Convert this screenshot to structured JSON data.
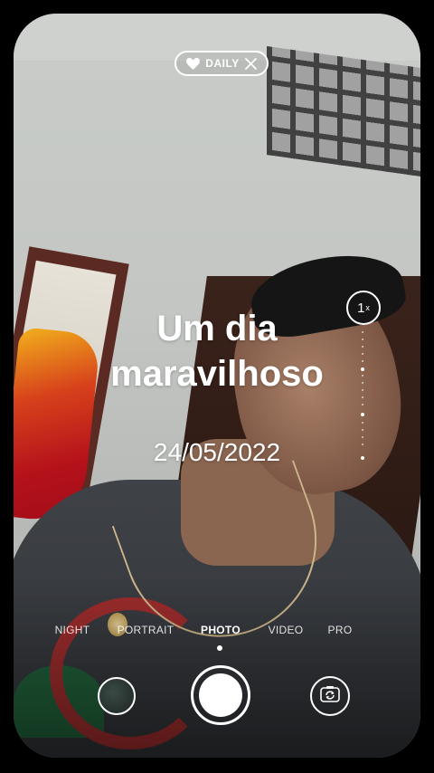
{
  "top_badge": {
    "label": "DAILY",
    "icon_left": "heart-icon",
    "icon_right": "close-icon"
  },
  "overlay": {
    "title_line1": "Um dia",
    "title_line2": "maravilhoso",
    "date": "24/05/2022"
  },
  "zoom": {
    "value": "1",
    "unit": "x"
  },
  "modes": {
    "items": [
      "NIGHT",
      "PORTRAIT",
      "PHOTO",
      "VIDEO",
      "PRO"
    ],
    "active": "PHOTO"
  },
  "controls": {
    "gallery": "gallery-thumbnail",
    "shutter": "shutter-button",
    "flip": "switch-camera-icon"
  }
}
